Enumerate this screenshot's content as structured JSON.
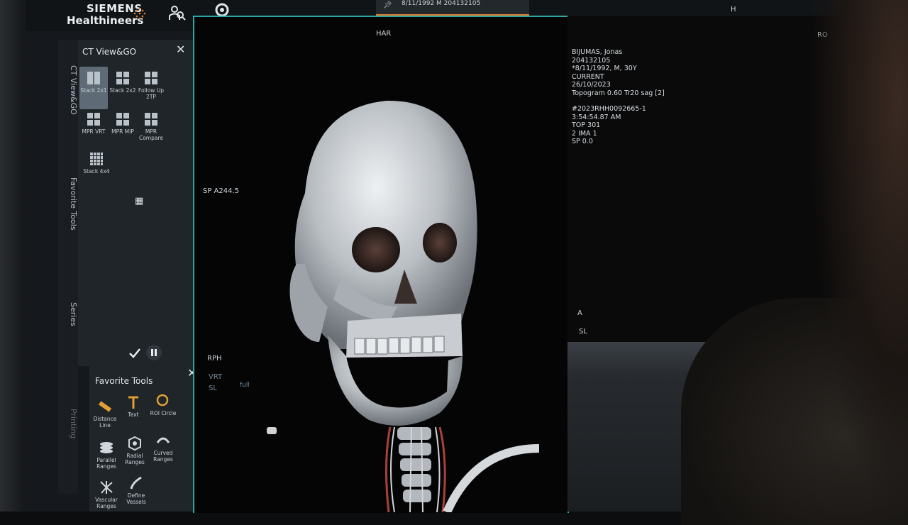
{
  "brand": {
    "line1": "SIEMENS",
    "line2": "Healthineers"
  },
  "top_tab": {
    "text": "8/11/1992 M 204132105"
  },
  "top_right_label": "H",
  "vertical_tabs": [
    "CT View&GO",
    "Favorite Tools",
    "Series",
    "Printing"
  ],
  "view_panel": {
    "title": "CT View&GO",
    "layouts": [
      {
        "label": "Stack 2x1",
        "selected": true
      },
      {
        "label": "Stack 2x2",
        "selected": false
      },
      {
        "label": "Follow Up 2TP",
        "selected": false
      },
      {
        "label": "MPR VRT",
        "selected": false
      },
      {
        "label": "MPR MIP",
        "selected": false
      },
      {
        "label": "MPR Compare",
        "selected": false
      },
      {
        "label": "Stack 4x4",
        "selected": false
      }
    ]
  },
  "favorite_tools": {
    "title": "Favorite Tools",
    "tools": [
      {
        "label": "Distance Line",
        "icon": "ruler-icon"
      },
      {
        "label": "Text",
        "icon": "text-icon"
      },
      {
        "label": "ROI Circle",
        "icon": "roi-circle-icon"
      },
      {
        "label": "Parallel Ranges",
        "icon": "parallel-ranges-icon"
      },
      {
        "label": "Radial Ranges",
        "icon": "radial-ranges-icon"
      },
      {
        "label": "Curved Ranges",
        "icon": "curved-ranges-icon"
      },
      {
        "label": "Vascular Ranges",
        "icon": "vascular-ranges-icon"
      },
      {
        "label": "Define Vessels",
        "icon": "define-vessels-icon"
      }
    ]
  },
  "main_viewport": {
    "top_label": "HAR",
    "left_label": "SP A244.5",
    "bottom_left_label": "RPH",
    "mode_label": "VRT",
    "slice_label": "SL",
    "full_label": "full"
  },
  "right_viewport": {
    "top_right_label": "RO",
    "info": [
      "BIJUMAS, Jonas",
      "204132105",
      "*8/11/1992, M, 30Y",
      "CURRENT",
      "26/10/2023",
      "Topogram 0.60 Tr20 sag [2]",
      "",
      "#2023RHH0092665-1",
      "3:54:54.87 AM",
      "TOP 301",
      "2 IMA 1",
      "SP 0.0"
    ],
    "orient_label": "A",
    "slice_label": "SL"
  },
  "colors": {
    "accent_frame": "#2aa7a2",
    "tab_underline": "#e17d2f",
    "selected_layout": "#5e6b76"
  }
}
